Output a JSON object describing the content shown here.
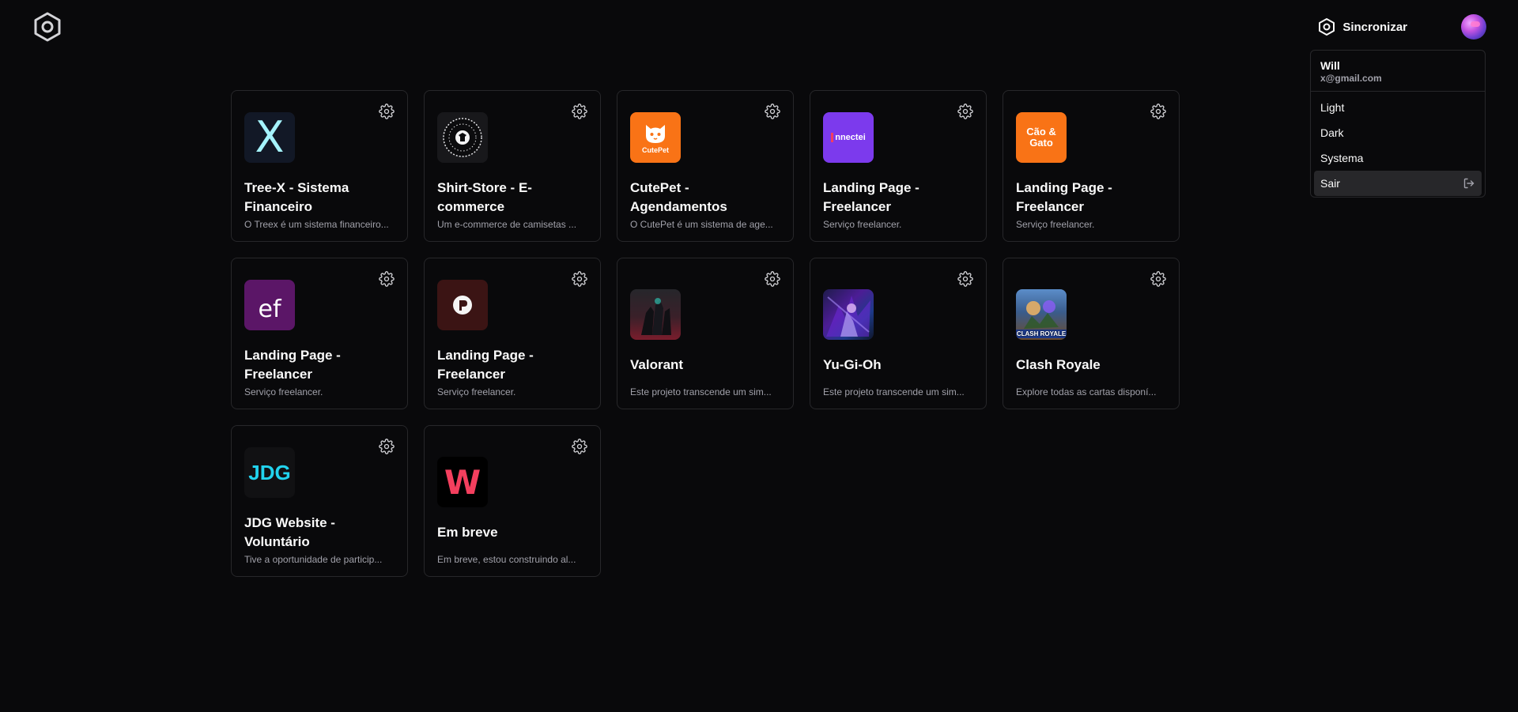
{
  "header": {
    "logo_icon": "hexagon-logo-icon",
    "sync_label": "Sincronizar",
    "sync_icon": "hexagon-sync-icon"
  },
  "user_menu": {
    "name": "Will",
    "email": "x@gmail.com",
    "items": [
      {
        "label": "Light"
      },
      {
        "label": "Dark"
      },
      {
        "label": "Systema"
      },
      {
        "label": "Sair",
        "icon": "logout-icon"
      }
    ]
  },
  "projects": [
    {
      "title": "Tree-X - Sistema Financeiro",
      "desc": "O Treex é um sistema financeiro...",
      "logo_text": "X",
      "logo_bg": "#121826",
      "logo_color": "#a5f3fc"
    },
    {
      "title": "Shirt-Store - E-commerce",
      "desc": "Um e-commerce de camisetas ...",
      "logo_text": "",
      "logo_bg": "#18181b",
      "logo_color": "#ffffff"
    },
    {
      "title": "CutePet - Agendamentos",
      "desc": "O CutePet é um sistema de age...",
      "logo_text": "CutePet",
      "logo_bg": "#f97316",
      "logo_color": "#ffffff"
    },
    {
      "title": "Landing Page - Freelancer",
      "desc": "Serviço freelancer.",
      "logo_text": "nnectei",
      "logo_bg": "#7c3aed",
      "logo_color": "#ffffff"
    },
    {
      "title": "Landing Page - Freelancer",
      "desc": "Serviço freelancer.",
      "logo_text": "Cão & Gato",
      "logo_bg": "#f97316",
      "logo_color": "#ffffff"
    },
    {
      "title": "Landing Page - Freelancer",
      "desc": "Serviço freelancer.",
      "logo_text": "ef",
      "logo_bg": "#5b1667",
      "logo_color": "#ffffff"
    },
    {
      "title": "Landing Page - Freelancer",
      "desc": "Serviço freelancer.",
      "logo_text": "",
      "logo_bg": "#3b1414",
      "logo_color": "#ffffff"
    },
    {
      "title": "Valorant",
      "desc": "Este projeto transcende um sim...",
      "logo_text": "",
      "logo_bg": "#2b1d24",
      "logo_color": "#ffffff"
    },
    {
      "title": "Yu-Gi-Oh",
      "desc": "Este projeto transcende um sim...",
      "logo_text": "",
      "logo_bg": "#2a1e5c",
      "logo_color": "#ffffff"
    },
    {
      "title": "Clash Royale",
      "desc": "Explore todas as cartas disponí...",
      "logo_text": "CLASH ROYALE",
      "logo_bg": "#3a5c8c",
      "logo_color": "#ffffff"
    },
    {
      "title": "JDG Website - Voluntário",
      "desc": "Tive a oportunidade de particip...",
      "logo_text": "JDG",
      "logo_bg": "#111113",
      "logo_color": "#22d3ee"
    },
    {
      "title": "Em breve",
      "desc": "Em breve, estou construindo al...",
      "logo_text": "W",
      "logo_bg": "#000000",
      "logo_color": "#f43f5e"
    }
  ],
  "icons": {
    "card_settings": "gear-icon"
  }
}
